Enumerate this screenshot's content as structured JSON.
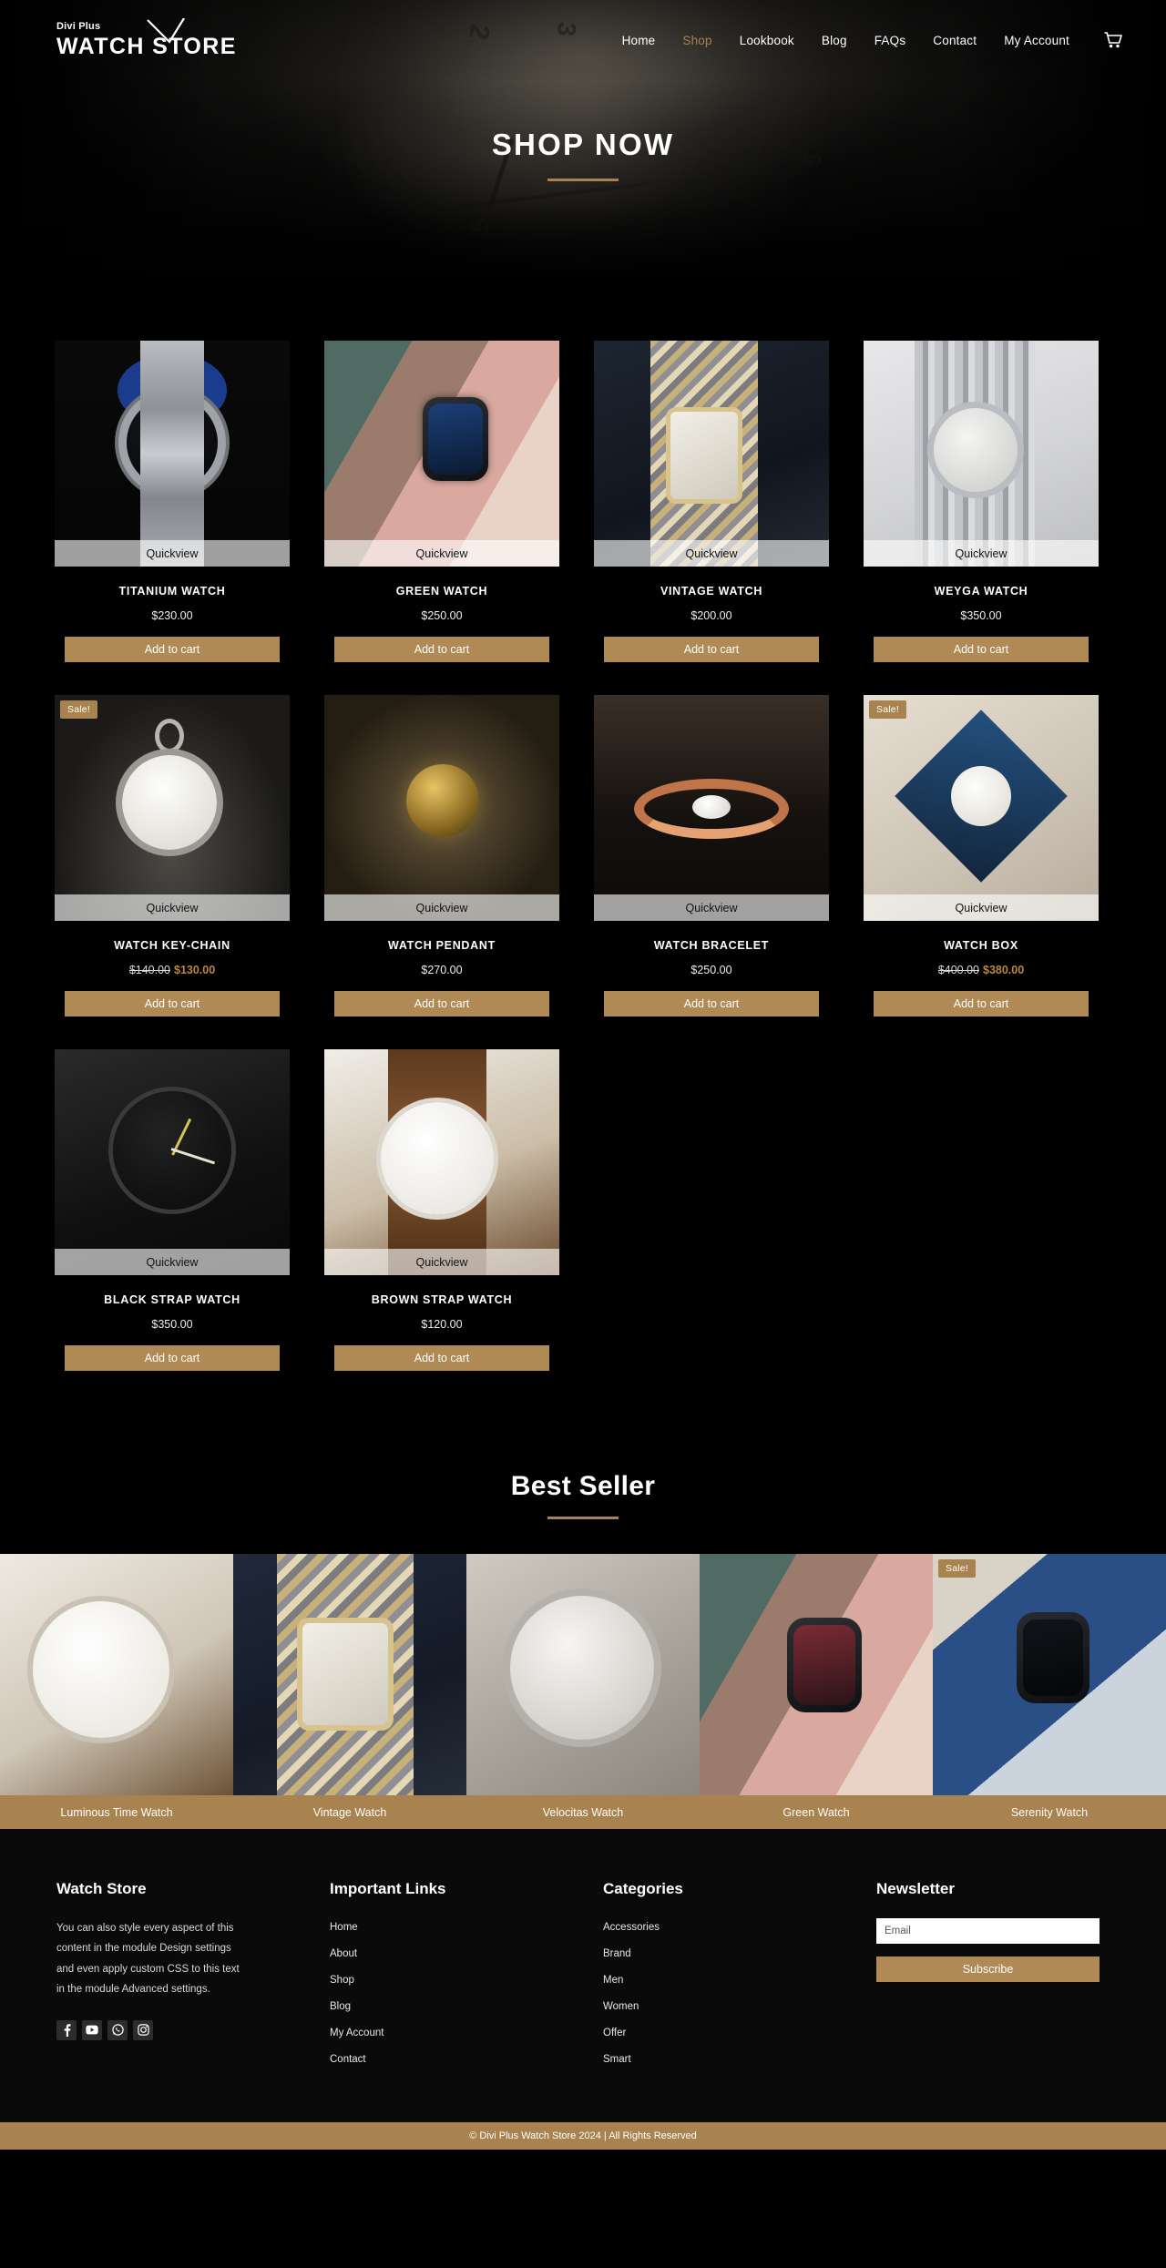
{
  "header": {
    "logo_small": "Divi Plus",
    "logo_main": "WATCH STORE",
    "nav": [
      {
        "label": "Home",
        "active": false
      },
      {
        "label": "Shop",
        "active": true
      },
      {
        "label": "Lookbook",
        "active": false
      },
      {
        "label": "Blog",
        "active": false
      },
      {
        "label": "FAQs",
        "active": false
      },
      {
        "label": "Contact",
        "active": false
      },
      {
        "label": "My Account",
        "active": false
      }
    ],
    "cart_icon": "shopping-cart-icon"
  },
  "hero": {
    "title": "SHOP NOW"
  },
  "shop": {
    "quickview_label": "Quickview",
    "add_to_cart_label": "Add to cart",
    "sale_badge_label": "Sale!",
    "products": [
      {
        "name": "TITANIUM WATCH",
        "price": "$230.00",
        "on_sale": false,
        "img": "img-titanium"
      },
      {
        "name": "GREEN WATCH",
        "price": "$250.00",
        "on_sale": false,
        "img": "img-green"
      },
      {
        "name": "VINTAGE WATCH",
        "price": "$200.00",
        "on_sale": false,
        "img": "img-vintage"
      },
      {
        "name": "WEYGA WATCH",
        "price": "$350.00",
        "on_sale": false,
        "img": "img-weyga"
      },
      {
        "name": "WATCH KEY-CHAIN",
        "price": "$130.00",
        "old_price": "$140.00",
        "on_sale": true,
        "img": "img-keychain"
      },
      {
        "name": "WATCH PENDANT",
        "price": "$270.00",
        "on_sale": false,
        "img": "img-pendant"
      },
      {
        "name": "WATCH BRACELET",
        "price": "$250.00",
        "on_sale": false,
        "img": "img-bracelet"
      },
      {
        "name": "WATCH BOX",
        "price": "$380.00",
        "old_price": "$400.00",
        "on_sale": true,
        "img": "img-box"
      },
      {
        "name": "BLACK STRAP WATCH",
        "price": "$350.00",
        "on_sale": false,
        "img": "img-black"
      },
      {
        "name": "BROWN STRAP WATCH",
        "price": "$120.00",
        "on_sale": false,
        "img": "img-brown"
      }
    ]
  },
  "bestseller": {
    "title": "Best Seller",
    "sale_badge_label": "Sale!",
    "items": [
      {
        "name": "Luminous Time Watch",
        "on_sale": false,
        "img": "img-lum"
      },
      {
        "name": "Vintage Watch",
        "on_sale": false,
        "img": "img-vin2"
      },
      {
        "name": "Velocitas Watch",
        "on_sale": false,
        "img": "img-vel"
      },
      {
        "name": "Green Watch",
        "on_sale": false,
        "img": "img-grn2"
      },
      {
        "name": "Serenity Watch",
        "on_sale": true,
        "img": "img-ser"
      }
    ]
  },
  "footer": {
    "about": {
      "heading": "Watch Store",
      "text": "You can also style every aspect of this content in the module Design settings and even apply custom CSS to this text in the module Advanced settings.",
      "socials": [
        "facebook-icon",
        "youtube-icon",
        "whatsapp-icon",
        "instagram-icon"
      ]
    },
    "links": {
      "heading": "Important Links",
      "items": [
        "Home",
        "About",
        "Shop",
        "Blog",
        "My Account",
        "Contact"
      ]
    },
    "categories": {
      "heading": "Categories",
      "items": [
        "Accessories",
        "Brand",
        "Men",
        "Women",
        "Offer",
        "Smart"
      ]
    },
    "newsletter": {
      "heading": "Newsletter",
      "email_placeholder": "Email",
      "email_value": "",
      "subscribe_label": "Subscribe"
    }
  },
  "copyright": {
    "text": "© Divi Plus Watch Store 2024 | All Rights Reserved"
  },
  "colors": {
    "accent": "#a8824f",
    "button": "#b08a55",
    "sale_price": "#b8873f",
    "background": "#000000"
  }
}
